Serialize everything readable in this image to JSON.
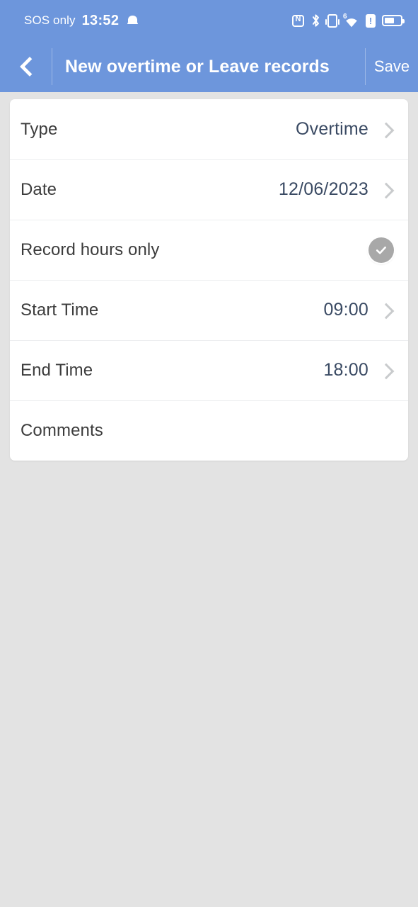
{
  "status_bar": {
    "carrier": "SOS only",
    "time": "13:52",
    "icons_left": [
      "bell-icon"
    ],
    "icons_right": [
      "nfc-icon",
      "bluetooth-icon",
      "vibrate-icon",
      "wifi-6-icon",
      "sim-alert-icon",
      "battery-icon"
    ],
    "wifi_generation": "6",
    "battery_level_percent": 55
  },
  "app_bar": {
    "back_label": "‹",
    "title": "New overtime or Leave records",
    "save_label": "Save"
  },
  "form": {
    "rows": [
      {
        "label": "Type",
        "value": "Overtime",
        "control": "chevron"
      },
      {
        "label": "Date",
        "value": "12/06/2023",
        "control": "chevron"
      },
      {
        "label": "Record hours only",
        "value": "",
        "control": "check-toggle",
        "checked": false
      },
      {
        "label": "Start Time",
        "value": "09:00",
        "control": "chevron"
      },
      {
        "label": "End Time",
        "value": "18:00",
        "control": "chevron"
      },
      {
        "label": "Comments",
        "value": "",
        "control": "none"
      }
    ]
  },
  "colors": {
    "accent": "#6d96dc",
    "page_background": "#e3e3e3",
    "card_background": "#ffffff",
    "label_text": "#3c3c3c",
    "value_text": "#3a4a63",
    "chevron": "#c9cbcd",
    "toggle_off": "#a8a8a8"
  }
}
